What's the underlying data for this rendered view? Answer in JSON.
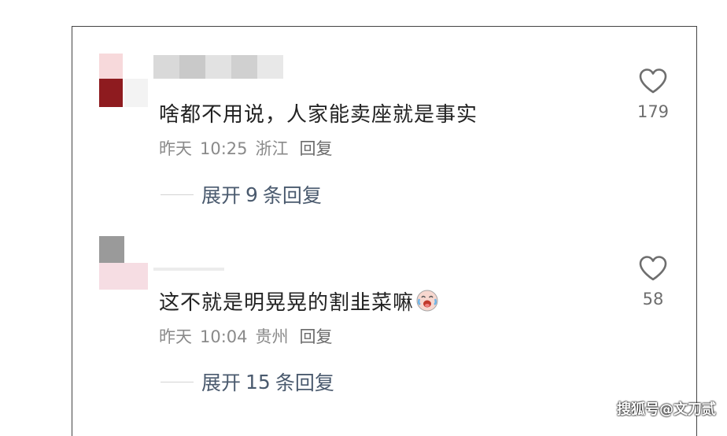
{
  "comments": [
    {
      "text": "啥都不用说，人家能卖座就是事实",
      "date": "昨天",
      "time": "10:25",
      "location": "浙江",
      "reply_label": "回复",
      "expand_prefix": "展开",
      "expand_count": "9",
      "expand_suffix": "条回复",
      "likes": "179"
    },
    {
      "text": "这不就是明晃晃的割韭菜嘛",
      "emoji_icon": "crying-laughing-emoji",
      "date": "昨天",
      "time": "10:04",
      "location": "贵州",
      "reply_label": "回复",
      "expand_prefix": "展开",
      "expand_count": "15",
      "expand_suffix": "条回复",
      "likes": "58"
    }
  ],
  "watermark": "搜狐号@文刀贰",
  "colors": {
    "text": "#222222",
    "meta": "#8a8a8a",
    "expand": "#4a5a6e",
    "like_icon": "#6e6e6e"
  }
}
